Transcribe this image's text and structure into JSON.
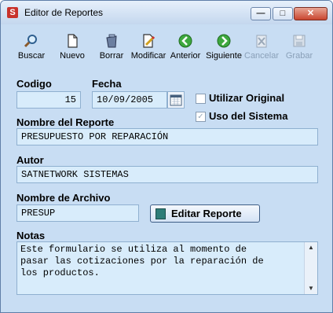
{
  "window": {
    "title": "Editor de Reportes",
    "minimize": "—",
    "maximize": "□",
    "close": "✕"
  },
  "toolbar": [
    {
      "label": "Buscar",
      "icon": "search-icon",
      "enabled": true
    },
    {
      "label": "Nuevo",
      "icon": "new-document-icon",
      "enabled": true
    },
    {
      "label": "Borrar",
      "icon": "trash-icon",
      "enabled": true
    },
    {
      "label": "Modificar",
      "icon": "edit-document-icon",
      "enabled": true
    },
    {
      "label": "Anterior",
      "icon": "previous-arrow-icon",
      "enabled": true
    },
    {
      "label": "Siguiente",
      "icon": "next-arrow-icon",
      "enabled": true
    },
    {
      "label": "Cancelar",
      "icon": "cancel-icon",
      "enabled": false
    },
    {
      "label": "Grabar",
      "icon": "save-icon",
      "enabled": false
    }
  ],
  "form": {
    "codigo_label": "Codigo",
    "codigo_value": "15",
    "fecha_label": "Fecha",
    "fecha_value": "10/09/2005",
    "utilizar_original_label": "Utilizar Original",
    "utilizar_original_checked": false,
    "uso_sistema_label": "Uso del Sistema",
    "uso_sistema_checked": true,
    "nombre_label": "Nombre del Reporte",
    "nombre_value": "PRESUPUESTO POR REPARACIÓN",
    "autor_label": "Autor",
    "autor_value": "SATNETWORK SISTEMAS",
    "archivo_label": "Nombre de Archivo",
    "archivo_value": "PRESUP",
    "edit_button_label": "Editar Reporte",
    "notas_label": "Notas",
    "notas_value": "Este formulario se utiliza al momento de\npasar las cotizaciones por la reparación de\nlos productos."
  }
}
